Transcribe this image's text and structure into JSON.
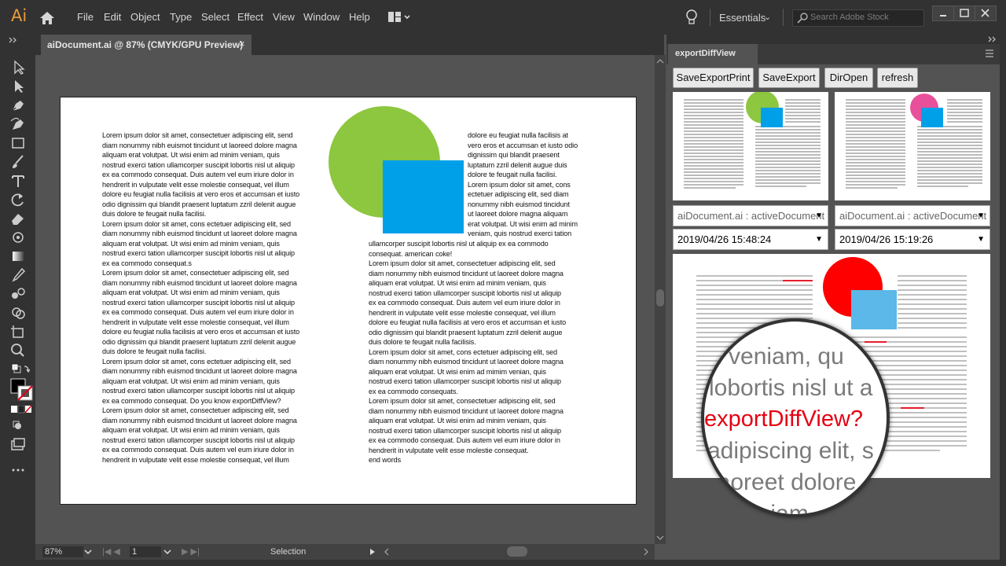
{
  "app": {
    "logo": "Ai",
    "menus": [
      "File",
      "Edit",
      "Object",
      "Type",
      "Select",
      "Effect",
      "View",
      "Window",
      "Help"
    ],
    "workspace": "Essentials",
    "search_placeholder": "Search Adobe Stock"
  },
  "document": {
    "tab_title": "aiDocument.ai @ 87% (CMYK/GPU Preview)",
    "close_glyph": "×",
    "column1": "Lorem ipsum dolor sit amet, consectetuer adipiscing elit, send\ndiam nonummy nibh euismot tincidunt ut laoreed dolore magna\naliquam erat volutpat. Ut wisi enim ad minim veniam, quis\nnostrud exerci tation ullamcorper suscipit lobortis nisl ut aliquip\nex ea commodo consequat. Duis autem vel eum iriure dolor in\nhendrerit in vulputate velit esse molestie consequat, vel illum\ndolore eu feugiat nulla facilisis at vero eros et accumsan et iusto\nodio dignissim qui blandit praesent luptatum zzril delenit augue\nduis dolore te feugait nulla facilisi.\nLorem ipsum dolor sit amet, cons ectetuer adipiscing elit, sed\ndiam nonummy nibh euismod tincidunt ut laoreet dolore magna\naliquam erat volutpat. Ut wisi enim ad minim veniam, quis\nnostrud exerci tation ullamcorper suscipit lobortis nisl ut aliquip\nex ea commodo consequat.s\nLorem ipsum dolor sit amet, consectetuer adipiscing elit, sed\ndiam nonummy nibh euismod tincidunt ut laoreet dolore magna\naliquam erat volutpat. Ut wisi enim ad minim veniam, quis\nnostrud exerci tation ullamcorper suscipit lobortis nisl ut aliquip\nex ea commodo consequat. Duis autem vel eum iriure dolor in\nhendrerit in vulputate velit esse molestie consequat, vel illum\ndolore eu feugiat nulla facilisis at vero eros et accumsan et iusto\nodio dignissim qui blandit praesent luptatum zzril delenit augue\nduis dolore te feugait nulla facilisi.\nLorem ipsum dolor sit amet, cons ectetuer adipiscing elit, sed\ndiam nonummy nibh euismod tincidunt ut laoreet dolore magna\naliquam erat volutpat. Ut wisi enim ad minim veniam, quis\nnostrud exerci tation ullamcorper suscipit lobortis nisl ut aliquip\nex ea commodo consequat. Do you know exportDiffView?\nLorem ipsum dolor sit amet, consectetuer adipiscing elit, sed\ndiam nonummy nibh euismod tincidunt ut laoreet dolore magna\naliquam erat volutpat. Ut wisi enim ad minim veniam, quis\nnostrud exerci tation ullamcorper suscipit lobortis nisl ut aliquip\nex ea commodo consequat. Duis autem vel eum iriure dolor in\nhendrerit in vulputate velit esse molestie consequat, vel illum",
    "column2_top": "dolore eu feugiat nulla facilisis at\nvero eros et accumsan et iusto odio\ndignissim qui blandit praesent\nluptatum zzril delenit augue duis\ndolore te feugait nulla facilisi.\nLorem ipsum dolor sit amet, cons\nectetuer adipiscing elit, sed diam\nnonummy nibh euismod tincidunt\nut laoreet dolore magna aliquam\nerat volutpat. Ut wisi enim ad minim\nveniam, quis nostrud exerci tation",
    "column2_bottom": "ullamcorper suscipit lobortis nisl ut aliquip ex ea commodo\nconsequat. american coke!\nLorem ipsum dolor sit amet, consectetuer adipiscing elit, sed\ndiam nonummy nibh euismod tincidunt ut laoreet dolore magna\naliquam erat volutpat. Ut wisi enim ad minim veniam, quis\nnostrud exerci tation ullamcorper suscipit lobortis nisl ut aliquip\nex ea commodo consequat. Duis autem vel eum iriure dolor in\nhendrerit in vulputate velit esse molestie consequat, vel illum\ndolore eu feugiat nulla facilisis at vero eros et accumsan et iusto\nodio dignissim qui blandit praesent luptatum zzril delenit augue\nduis dolore te feugait nulla facilisis.\nLorem ipsum dolor sit amet, cons ectetuer adipiscing elit, sed\ndiam nonummy nibh euismod tincidunt ut laoreet dolore magna\naliquam erat volutpat. Ut wisi enim ad mimim venian, quis\nnostrud exerci tation ullamcorper suscipit lobortis nisl ut aliquip\nex ea commodo consequats.\nLorem ipsum dolor sit amet, consectetuer adipiscing elit, sed\ndiam nonummy nibh euismod tincidunt ut laoreet dolore magna\naliquam erat volutpat. Ut wisi enim ad minim veniam, quis\nnostrud exerci tation ullamcorper suscipit lobortis nisl ut aliquip\nex ea commodo consequat. Duis autem vel eum iriure dolor in\nhendrerit in vulputate velit esse molestie consequat.\nend words",
    "colors": {
      "circle": "#8dc63f",
      "square": "#00a0e9"
    }
  },
  "status": {
    "zoom": "87%",
    "page": "1",
    "tool": "Selection"
  },
  "panel": {
    "title": "exportDiffView",
    "buttons": [
      "SaveExportPrint",
      "SaveExport",
      "DirOpen",
      "refresh"
    ],
    "left": {
      "document": "aiDocument.ai : activeDocument",
      "date": "2019/04/26 15:48:24",
      "circle_color": "#8dc63f"
    },
    "right": {
      "document": "aiDocument.ai : activeDocument",
      "date": "2019/04/26 15:19:26",
      "circle_color": "#e8509b"
    },
    "diff": {
      "magnifier_lines": [
        "n veniam, qu",
        "lobortis nisl ut a",
        "exportDiffView?",
        "adipiscing elit, s",
        "laoreet dolore",
        "veniam"
      ],
      "highlight_color": "#e60012",
      "diff_circle_color": "#ff0000",
      "diff_square_color": "#5bb8e8"
    }
  }
}
